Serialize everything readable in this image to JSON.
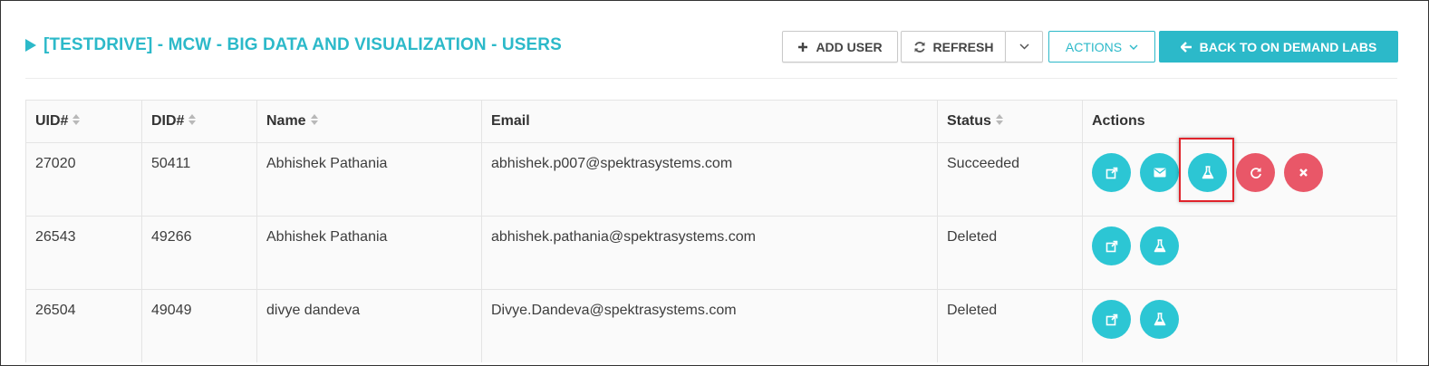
{
  "page": {
    "title": "[TESTDRIVE] - MCW - BIG DATA AND VISUALIZATION - USERS"
  },
  "toolbar": {
    "add_user_label": "ADD USER",
    "refresh_label": "REFRESH",
    "actions_label": "ACTIONS",
    "back_label": "BACK TO ON DEMAND LABS"
  },
  "table": {
    "columns": [
      "UID#",
      "DID#",
      "Name",
      "Email",
      "Status",
      "Actions"
    ],
    "rows": [
      {
        "uid": "27020",
        "did": "50411",
        "name": "Abhishek Pathania",
        "email": "abhishek.p007@spektrasystems.com",
        "status": "Succeeded",
        "actions": [
          "external-link-icon",
          "envelope-icon",
          "flask-icon",
          "refresh-icon",
          "delete-icon"
        ]
      },
      {
        "uid": "26543",
        "did": "49266",
        "name": "Abhishek Pathania",
        "email": "abhishek.pathania@spektrasystems.com",
        "status": "Deleted",
        "actions": [
          "external-link-icon",
          "flask-icon"
        ]
      },
      {
        "uid": "26504",
        "did": "49049",
        "name": "divye dandeva",
        "email": "Divye.Dandeva@spektrasystems.com",
        "status": "Deleted",
        "actions": [
          "external-link-icon",
          "flask-icon"
        ]
      }
    ]
  },
  "colors": {
    "accent": "#2cb9c9",
    "action_teal": "#2cc6d4",
    "action_red": "#e95768",
    "highlight": "#e0232b"
  }
}
